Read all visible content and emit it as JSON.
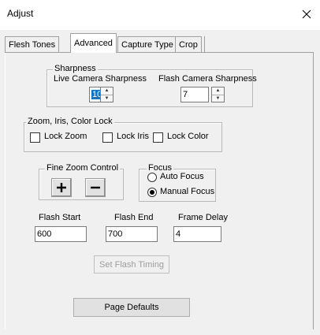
{
  "window": {
    "title": "Adjust",
    "close_glyph": "✕"
  },
  "tabs": [
    {
      "label": "Flesh Tones",
      "active": false
    },
    {
      "label": "Advanced",
      "active": true
    },
    {
      "label": "Capture Type",
      "active": false
    },
    {
      "label": "Crop",
      "active": false
    }
  ],
  "sharpness": {
    "legend": "Sharpness",
    "live_label": "Live Camera Sharpness",
    "live_value": "10",
    "flash_label": "Flash Camera Sharpness",
    "flash_value": "7"
  },
  "lock_group": {
    "legend": "Zoom, Iris, Color Lock",
    "lock_zoom": "Lock Zoom",
    "lock_iris": "Lock Iris",
    "lock_color": "Lock Color"
  },
  "fine_zoom": {
    "legend": "Fine Zoom Control",
    "plus": "+",
    "minus": "−"
  },
  "focus": {
    "legend": "Focus",
    "auto_label": "Auto Focus",
    "manual_label": "Manual Focus",
    "selected": "Manual Focus"
  },
  "flash": {
    "start_label": "Flash Start",
    "start_value": "600",
    "end_label": "Flash End",
    "end_value": "700",
    "delay_label": "Frame Delay",
    "delay_value": "4",
    "set_timing_label": "Set Flash Timing"
  },
  "page_defaults_label": "Page Defaults"
}
